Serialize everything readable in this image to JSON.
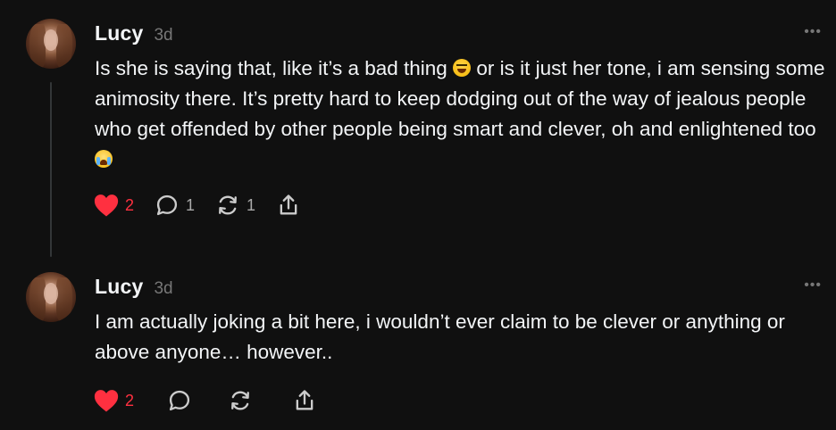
{
  "posts": [
    {
      "username": "Lucy",
      "timestamp": "3d",
      "more": "•••",
      "text_parts": {
        "a": "Is she is saying that, like it’s a bad thing",
        "b": " or is it just her tone, i am sensing some animosity there. It’s pretty hard to keep dodging out of the way of jealous people who get offended by other people being smart and clever, oh and enlightened too",
        "c": ""
      },
      "emojis": [
        "laughing-emoji",
        "crying-emoji"
      ],
      "likes": "2",
      "replies": "1",
      "reposts": "1",
      "liked": true
    },
    {
      "username": "Lucy",
      "timestamp": "3d",
      "more": "•••",
      "text": "I am actually joking a bit here, i wouldn’t ever claim to be clever or anything or above anyone… however..",
      "likes": "2",
      "replies": "",
      "reposts": "",
      "liked": true
    }
  ],
  "colors": {
    "background": "#101010",
    "text": "#f3f5f7",
    "muted": "#777777",
    "like": "#ff3040",
    "thread_line": "#333638"
  },
  "icons": [
    "heart-icon",
    "comment-icon",
    "repost-icon",
    "share-icon",
    "more-icon"
  ]
}
